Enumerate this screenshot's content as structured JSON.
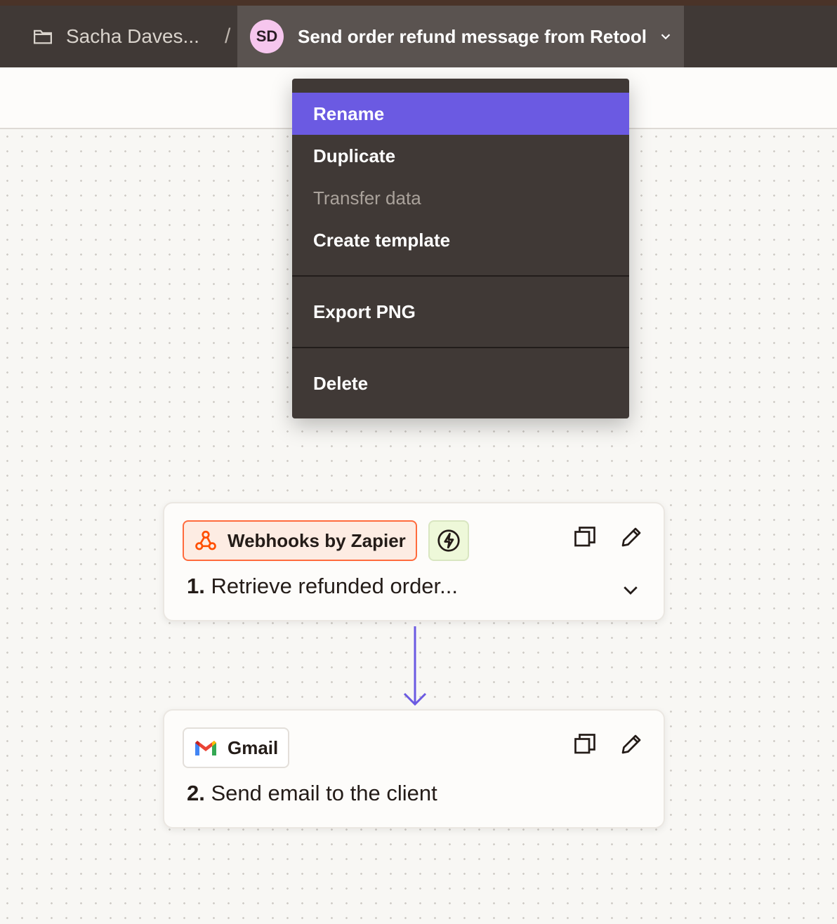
{
  "breadcrumb": {
    "folder_label": "Sacha Daves...",
    "separator": "/",
    "avatar_initials": "SD",
    "zap_title": "Send order refund message from Retool"
  },
  "menu": {
    "items": [
      {
        "label": "Rename",
        "state": "highlighted"
      },
      {
        "label": "Duplicate",
        "state": "enabled"
      },
      {
        "label": "Transfer data",
        "state": "disabled"
      },
      {
        "label": "Create template",
        "state": "enabled"
      },
      {
        "label": "Export PNG",
        "state": "enabled"
      },
      {
        "label": "Delete",
        "state": "enabled"
      }
    ]
  },
  "steps": [
    {
      "app_name": "Webhooks by Zapier",
      "app_icon": "webhook-icon",
      "number": "1.",
      "title": "Retrieve refunded order...",
      "is_trigger": true
    },
    {
      "app_name": "Gmail",
      "app_icon": "gmail-icon",
      "number": "2.",
      "title": "Send email to the client",
      "is_trigger": false
    }
  ],
  "colors": {
    "accent": "#6b5ae2",
    "topbar": "#403936",
    "menu_bg": "#403936",
    "webhook_orange": "#ff6b3d",
    "connector": "#6b5ae2"
  }
}
